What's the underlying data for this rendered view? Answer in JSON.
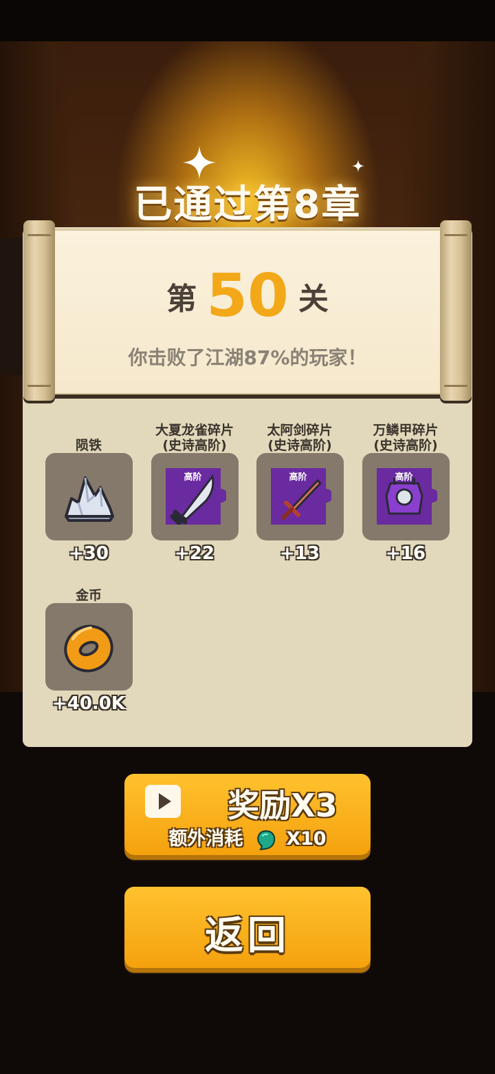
{
  "header": {
    "title": "已通过第8章"
  },
  "level": {
    "prefix": "第",
    "number": "50",
    "suffix": "关"
  },
  "beat_text": "你击败了江湖87%的玩家！",
  "rewards": [
    {
      "name_line1": "",
      "name_line2": "陨铁",
      "amount": "+30",
      "icon": "meteor-iron-crystal-icon",
      "badge": ""
    },
    {
      "name_line1": "大夏龙雀碎片",
      "name_line2": "(史诗高阶)",
      "amount": "+22",
      "icon": "dragon-sparrow-sword-shard-icon",
      "badge": "高阶"
    },
    {
      "name_line1": "太阿剑碎片",
      "name_line2": "(史诗高阶)",
      "amount": "+13",
      "icon": "taia-sword-shard-icon",
      "badge": "高阶"
    },
    {
      "name_line1": "万鳞甲碎片",
      "name_line2": "(史诗高阶)",
      "amount": "+16",
      "icon": "scale-armor-shard-icon",
      "badge": "高阶"
    },
    {
      "name_line1": "",
      "name_line2": "金币",
      "amount": "+40.0K",
      "icon": "gold-coin-icon",
      "badge": ""
    }
  ],
  "buttons": {
    "ad_reward_label": "奖励X3",
    "ad_cost_label": "额外消耗",
    "ad_cost_amount": "X10",
    "back_label": "返回"
  },
  "colors": {
    "accent": "#f2a818",
    "panel": "#e2d8bb",
    "shard_purple": "#6a2aa0",
    "button": "#f5a10e"
  }
}
